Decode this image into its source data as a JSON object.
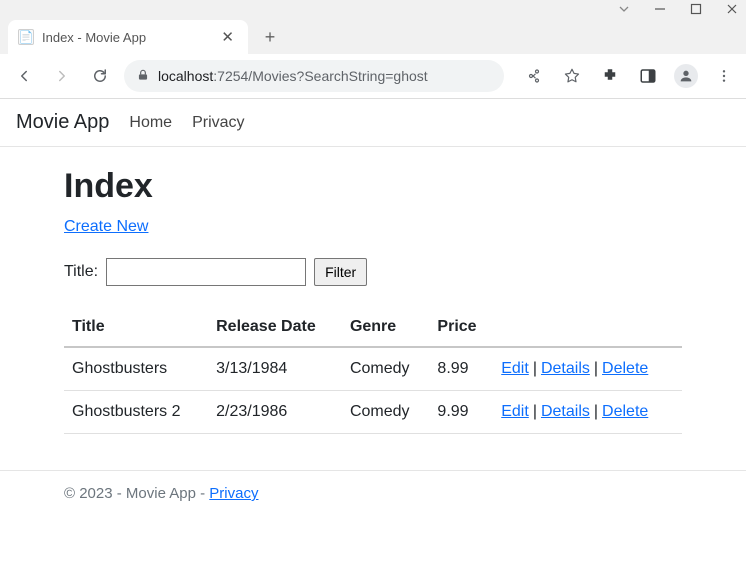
{
  "browser": {
    "tab_title": "Index - Movie App",
    "url_host": "localhost",
    "url_port_path": ":7254/Movies?SearchString=ghost"
  },
  "navbar": {
    "brand": "Movie App",
    "links": [
      "Home",
      "Privacy"
    ]
  },
  "page": {
    "heading": "Index",
    "create_link": "Create New",
    "search": {
      "label": "Title:",
      "value": "",
      "button": "Filter"
    },
    "columns": [
      "Title",
      "Release Date",
      "Genre",
      "Price"
    ],
    "rows": [
      {
        "title": "Ghostbusters",
        "release_date": "3/13/1984",
        "genre": "Comedy",
        "price": "8.99"
      },
      {
        "title": "Ghostbusters 2",
        "release_date": "2/23/1986",
        "genre": "Comedy",
        "price": "9.99"
      }
    ],
    "row_actions": {
      "edit": "Edit",
      "details": "Details",
      "delete": "Delete"
    },
    "footer": {
      "prefix": "© 2023 - Movie App - ",
      "privacy": "Privacy"
    }
  }
}
